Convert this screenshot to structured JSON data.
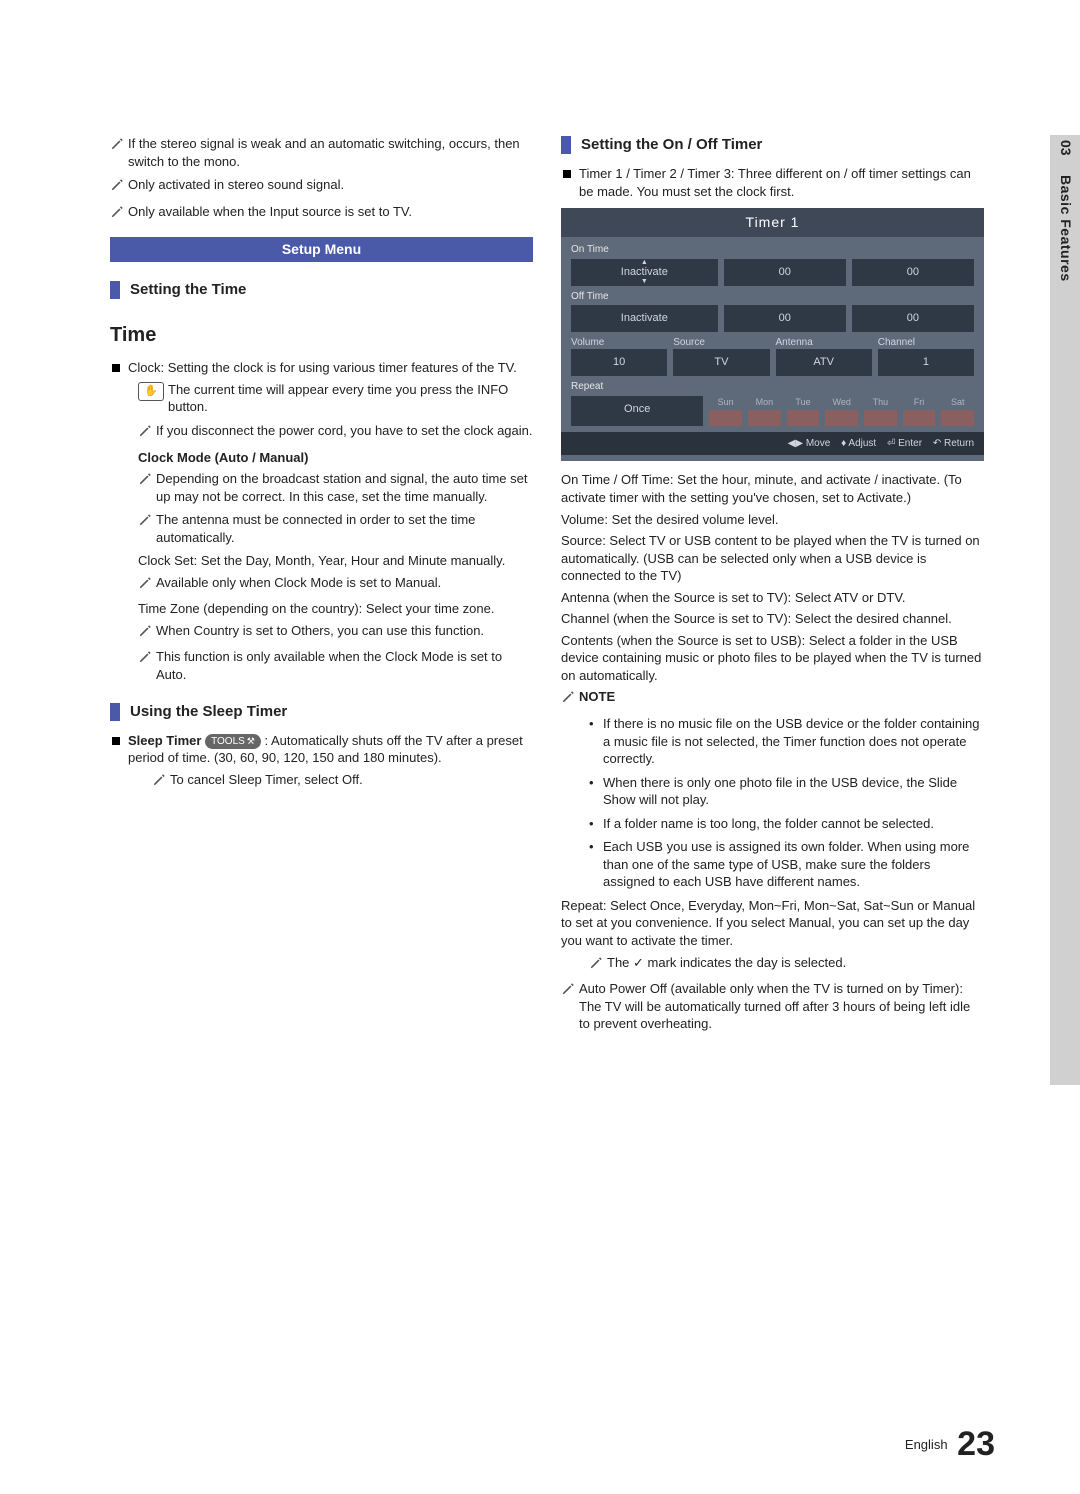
{
  "sidebar": {
    "section_number": "03",
    "section_label": "Basic Features"
  },
  "left": {
    "notes": [
      "If the stereo signal is weak and an automatic switching, occurs, then switch to the mono.",
      "Only activated in stereo sound signal.",
      "Only available when the Input source is set to TV."
    ],
    "setup_menu": "Setup Menu",
    "setting_time": "Setting the Time",
    "time_h": "Time",
    "clock_lead": "Clock: Setting the clock is for using various timer features of the TV.",
    "hand_note": "The current time will appear every time you press the INFO button.",
    "disconnect": "If you disconnect the power cord, you have to set the clock again.",
    "clock_mode_h": "Clock Mode (Auto / Manual)",
    "clock_mode_n1": "Depending on the broadcast station and signal, the auto time set up may not be correct. In this case, set the time manually.",
    "clock_mode_n2": "The antenna must be connected in order to set the time automatically.",
    "clock_set": "Clock Set: Set the Day, Month, Year, Hour and Minute manually.",
    "clock_set_n": "Available only when Clock Mode is set to Manual.",
    "tz": "Time Zone (depending on the country): Select your time zone.",
    "tz_n1": "When Country is set to Others, you can use this function.",
    "tz_n2": "This function is only available when the Clock Mode is set to Auto.",
    "sleep_h": "Using the Sleep Timer",
    "sleep_lead_a": "Sleep Timer ",
    "sleep_tools": "TOOLS",
    "sleep_lead_b": " : Automatically shuts off the TV after a preset period of time. (30, 60, 90, 120, 150 and 180 minutes).",
    "sleep_cancel": "To cancel Sleep Timer, select Off."
  },
  "right": {
    "onoff_h": "Setting the On / Off Timer",
    "timer_lead": "Timer 1 / Timer 2 / Timer 3: Three different on / off timer settings can be made. You must set the clock first.",
    "panel": {
      "title": "Timer 1",
      "on_time": "On Time",
      "off_time": "Off Time",
      "inactivate": "Inactivate",
      "zero": "00",
      "vol": "Volume",
      "src": "Source",
      "ant": "Antenna",
      "ch": "Channel",
      "v10": "10",
      "tv": "TV",
      "atv": "ATV",
      "one": "1",
      "repeat": "Repeat",
      "once": "Once",
      "days": [
        "Sun",
        "Mon",
        "Tue",
        "Wed",
        "Thu",
        "Fri",
        "Sat"
      ],
      "foot_move": "◀▶ Move",
      "foot_adj": "♦ Adjust",
      "foot_enter": "⏎ Enter",
      "foot_ret": "↶ Return"
    },
    "p_ontime": "On Time / Off Time: Set the hour, minute, and activate / inactivate. (To activate timer with the setting you've chosen, set to Activate.)",
    "p_volume": "Volume: Set the desired volume level.",
    "p_source": "Source: Select TV or USB content to be played when the TV is turned on automatically. (USB can be selected only when a USB device is connected to the TV)",
    "p_antenna": "Antenna (when the Source is set to TV): Select ATV or DTV.",
    "p_channel": "Channel (when the Source is set to TV): Select the desired channel.",
    "p_contents": "Contents (when the Source is set to USB): Select a folder in the USB device containing music or photo files to be played when the TV is turned on automatically.",
    "note_h": "NOTE",
    "note_items": [
      "If there is no music file on the USB device or the folder containing a music file is not selected, the Timer function does not operate correctly.",
      "When there is only one photo file in the USB device, the Slide Show will not play.",
      "If a folder name is too long, the folder cannot be selected.",
      "Each USB you use is assigned its own folder. When using more than one of the same type of USB, make sure the folders assigned to each USB have different names."
    ],
    "p_repeat": "Repeat: Select Once, Everyday, Mon~Fri, Mon~Sat, Sat~Sun or Manual to set at you convenience. If you select Manual, you can set up the day you want to activate the timer.",
    "check_note": "The ✓ mark indicates the day is selected.",
    "autopower": "Auto Power Off (available only when the TV is turned on by Timer): The TV will be automatically turned off after 3 hours of being left idle to prevent overheating."
  },
  "footer": {
    "lang": "English",
    "page": "23"
  }
}
